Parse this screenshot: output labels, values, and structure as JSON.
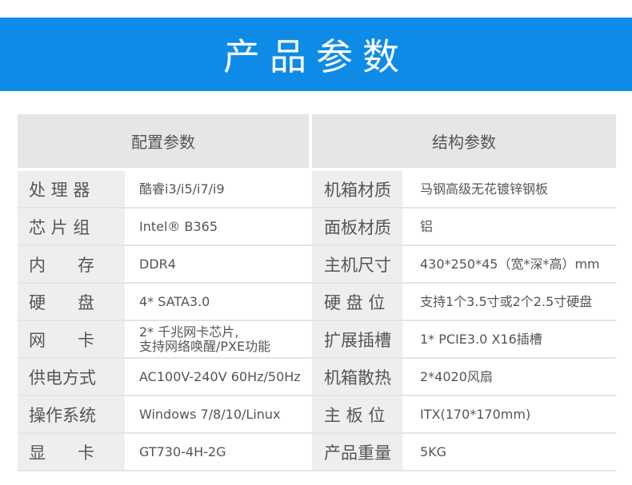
{
  "banner": {
    "title": "产品参数"
  },
  "headers": {
    "left": "配置参数",
    "right": "结构参数"
  },
  "rows": [
    {
      "l_label": "处 理 器",
      "l_value": "酷睿i3/i5/i7/i9",
      "r_label": "机箱材质",
      "r_value": "马钢高级无花镀锌钢板"
    },
    {
      "l_label": "芯 片 组",
      "l_value": "Intel® B365",
      "r_label": "面板材质",
      "r_value": "铝"
    },
    {
      "l_label": "内      存",
      "l_value": "DDR4",
      "r_label": "主机尺寸",
      "r_value": "430*250*45（宽*深*高）mm"
    },
    {
      "l_label": "硬      盘",
      "l_value": "4* SATA3.0",
      "r_label": "硬 盘 位",
      "r_value": "支持1个3.5寸或2个2.5寸硬盘"
    },
    {
      "l_label": "网      卡",
      "l_value": "2* 千兆网卡芯片,\n支持网络唤醒/PXE功能",
      "r_label": "扩展插槽",
      "r_value": "1* PCIE3.0 X16插槽"
    },
    {
      "l_label": "供电方式",
      "l_value": "AC100V-240V 60Hz/50Hz",
      "r_label": "机箱散热",
      "r_value": "2*4020风扇"
    },
    {
      "l_label": "操作系统",
      "l_value": "Windows 7/8/10/Linux",
      "r_label": "主 板 位",
      "r_value": "ITX(170*170mm)"
    },
    {
      "l_label": "显      卡",
      "l_value": "GT730-4H-2G",
      "r_label": "产品重量",
      "r_value": "5KG"
    }
  ]
}
